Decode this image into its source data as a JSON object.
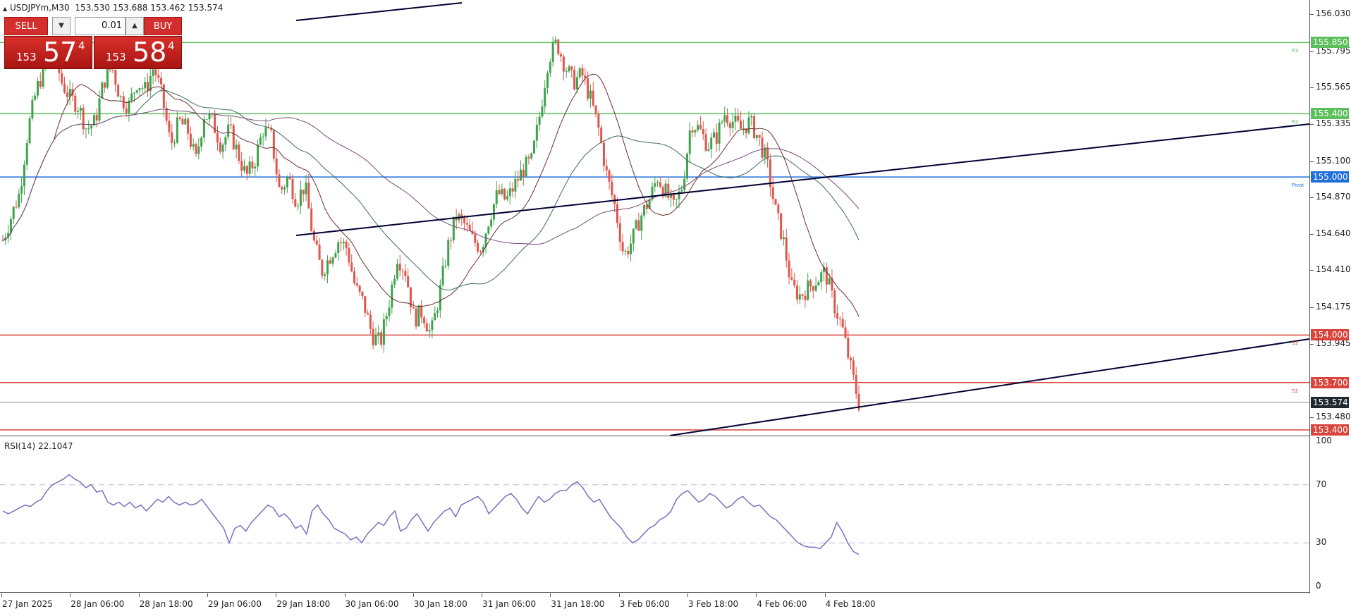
{
  "chart_header": {
    "arrow": "▲",
    "symbol_timeframe": "USDJPYm,M30",
    "ohlc": "153.530 153.688 153.462 153.574"
  },
  "trade_panel": {
    "sell_label": "SELL",
    "buy_label": "BUY",
    "volume": "0.01",
    "down_arrow": "▼",
    "up_arrow": "▲",
    "sell_quote": {
      "prefix": "153",
      "big": "57",
      "sup": "4"
    },
    "buy_quote": {
      "prefix": "153",
      "big": "58",
      "sup": "4"
    }
  },
  "price_axis": {
    "labels": [
      "156.030",
      "155.795",
      "155.565",
      "155.335",
      "155.100",
      "154.870",
      "154.640",
      "154.410",
      "154.175",
      "153.945",
      "153.480"
    ],
    "pivot_levels": [
      {
        "label": "155.850",
        "price": 155.85,
        "color": "#5bbf5b",
        "tag": "R3"
      },
      {
        "label": "155.400",
        "price": 155.4,
        "color": "#5bbf5b",
        "tag": "R2"
      },
      {
        "label": "155.000",
        "price": 155.0,
        "color": "#1e6fd9",
        "tag": "Pivot"
      },
      {
        "label": "154.000",
        "price": 154.0,
        "color": "#d9453c",
        "tag": "S1"
      },
      {
        "label": "153.700",
        "price": 153.7,
        "color": "#d9453c",
        "tag": "S2"
      },
      {
        "label": "153.400",
        "price": 153.4,
        "color": "#d9453c",
        "tag": ""
      }
    ],
    "current_price": {
      "label": "153.574",
      "price": 153.574,
      "color": "#1f2a2f"
    }
  },
  "rsi": {
    "title": "RSI(14) 22.1047",
    "levels": [
      "100",
      "70",
      "30",
      "0"
    ],
    "line_color": "#7b6fbf",
    "values": [
      52,
      50,
      52,
      54,
      56,
      55,
      58,
      60,
      66,
      70,
      72,
      74,
      77,
      74,
      72,
      68,
      70,
      65,
      66,
      58,
      56,
      58,
      55,
      58,
      54,
      56,
      52,
      56,
      60,
      58,
      62,
      58,
      56,
      58,
      56,
      57,
      60,
      55,
      50,
      45,
      40,
      30,
      40,
      42,
      38,
      44,
      48,
      52,
      56,
      54,
      48,
      50,
      46,
      40,
      42,
      36,
      52,
      56,
      50,
      46,
      40,
      38,
      36,
      32,
      34,
      30,
      36,
      40,
      44,
      42,
      48,
      52,
      38,
      40,
      46,
      50,
      44,
      38,
      44,
      48,
      52,
      54,
      48,
      56,
      58,
      60,
      62,
      58,
      50,
      54,
      58,
      62,
      64,
      60,
      54,
      50,
      56,
      62,
      58,
      60,
      64,
      66,
      66,
      70,
      72,
      68,
      62,
      58,
      60,
      54,
      48,
      44,
      40,
      34,
      30,
      32,
      36,
      40,
      42,
      46,
      48,
      52,
      60,
      64,
      66,
      62,
      58,
      60,
      64,
      62,
      58,
      54,
      56,
      60,
      62,
      58,
      55,
      56,
      52,
      48,
      46,
      42,
      38,
      34,
      30,
      28,
      27,
      27,
      26,
      30,
      34,
      44,
      38,
      30,
      24,
      22
    ]
  },
  "chart_data": {
    "type": "candlestick",
    "symbol": "USDJPYm",
    "timeframe": "M30",
    "ylim": [
      153.4,
      156.03
    ],
    "x_labels": [
      "27 Jan 2025",
      "28 Jan 06:00",
      "28 Jan 18:00",
      "29 Jan 06:00",
      "29 Jan 18:00",
      "30 Jan 06:00",
      "30 Jan 18:00",
      "31 Jan 06:00",
      "31 Jan 18:00",
      "3 Feb 06:00",
      "3 Feb 18:00",
      "4 Feb 06:00",
      "4 Feb 18:00"
    ],
    "close_path": [
      154.6,
      154.75,
      154.9,
      155.3,
      155.55,
      155.7,
      155.8,
      155.6,
      155.5,
      155.45,
      155.3,
      155.35,
      155.6,
      155.7,
      155.5,
      155.45,
      155.6,
      155.55,
      155.7,
      155.5,
      155.2,
      155.35,
      155.3,
      155.1,
      155.4,
      155.35,
      155.2,
      155.3,
      155.15,
      155.0,
      155.1,
      155.3,
      155.25,
      154.9,
      155.0,
      154.85,
      154.95,
      154.6,
      154.4,
      154.5,
      154.6,
      154.55,
      154.3,
      154.2,
      154.0,
      153.95,
      154.2,
      154.5,
      154.4,
      154.1,
      154.15,
      154.0,
      154.25,
      154.55,
      154.75,
      154.7,
      154.6,
      154.55,
      154.75,
      154.9,
      154.85,
      154.95,
      155.05,
      155.1,
      155.4,
      155.75,
      155.85,
      155.7,
      155.6,
      155.65,
      155.5,
      155.3,
      155.0,
      154.8,
      154.5,
      154.6,
      154.75,
      154.85,
      155.0,
      154.9,
      154.8,
      154.95,
      155.35,
      155.3,
      155.2,
      155.25,
      155.4,
      155.35,
      155.3,
      155.35,
      155.25,
      155.1,
      154.8,
      154.6,
      154.3,
      154.25,
      154.3,
      154.35,
      154.4,
      154.2,
      154.05,
      153.8,
      153.57
    ]
  }
}
